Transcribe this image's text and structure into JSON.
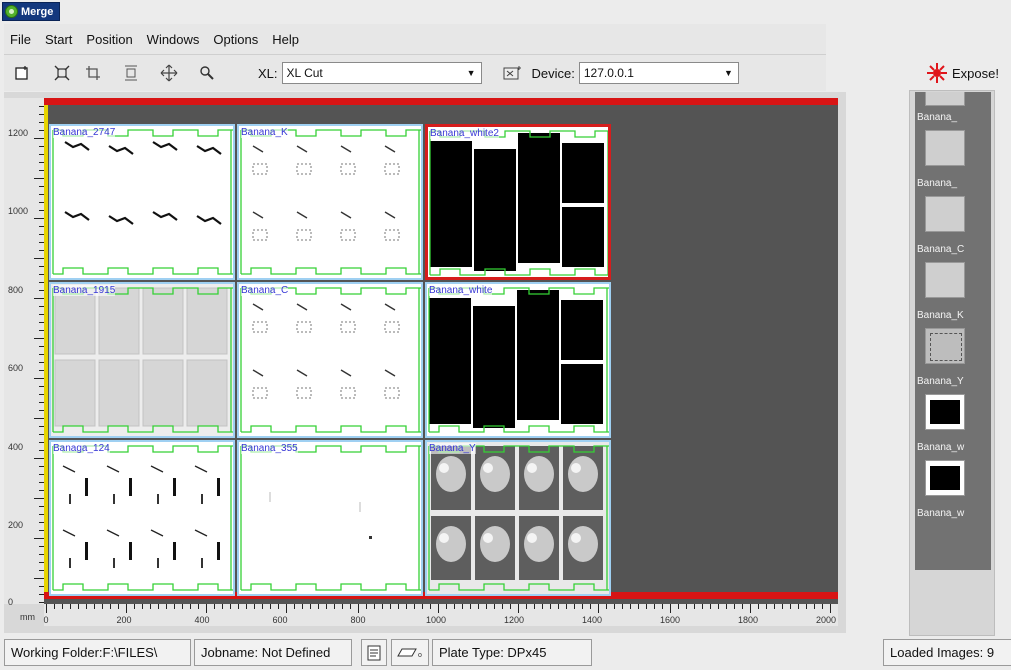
{
  "window": {
    "title": "Merge"
  },
  "menu": [
    "File",
    "Start",
    "Position",
    "Windows",
    "Options",
    "Help"
  ],
  "toolbar": {
    "buttons": [
      "new-icon",
      "fit-icon",
      "crop-icon",
      "center-icon",
      "move-icon",
      "zoom-icon"
    ],
    "xl_label": "XL:",
    "xl_value": "XL Cut",
    "device_label": "Device:",
    "device_value": "127.0.0.1",
    "expose_label": "Expose!"
  },
  "rulers": {
    "vertical": [
      "1200",
      "1000",
      "800",
      "600",
      "400",
      "200",
      "0"
    ],
    "horizontal": [
      "0",
      "200",
      "400",
      "600",
      "800",
      "1000",
      "1200",
      "1400",
      "1600",
      "1800",
      "2000"
    ],
    "unit": "mm"
  },
  "tiles": [
    {
      "label": "Banana_2747",
      "kind": "text"
    },
    {
      "label": "Banana_K",
      "kind": "sketch"
    },
    {
      "label": "Banana_white2",
      "kind": "black",
      "selected": true
    },
    {
      "label": "Banana_1915",
      "kind": "gray"
    },
    {
      "label": "Banana_C",
      "kind": "sketch"
    },
    {
      "label": "Banana_white",
      "kind": "black"
    },
    {
      "label": "Banaga_124",
      "kind": "sparse"
    },
    {
      "label": "Banana_355",
      "kind": "blank"
    },
    {
      "label": "Banana_Y",
      "kind": "photo"
    }
  ],
  "thumbnails": [
    "Banana_",
    "Banana_",
    "Banana_C",
    "Banana_K",
    "Banana_Y",
    "Banana_w",
    "Banana_w"
  ],
  "status": {
    "working_folder": "Working Folder:F:\\FILES\\",
    "jobname": "Jobname: Not Defined",
    "plate_type": "Plate Type: DPx45",
    "loaded_images": "Loaded Images: 9"
  },
  "colors": {
    "title_bg": "#13387e",
    "canvas": "#545454",
    "accent_red": "#d71414",
    "tile_border": "#9fd0f2",
    "tile_label": "#3737d5",
    "cut_line": "#35d135"
  }
}
